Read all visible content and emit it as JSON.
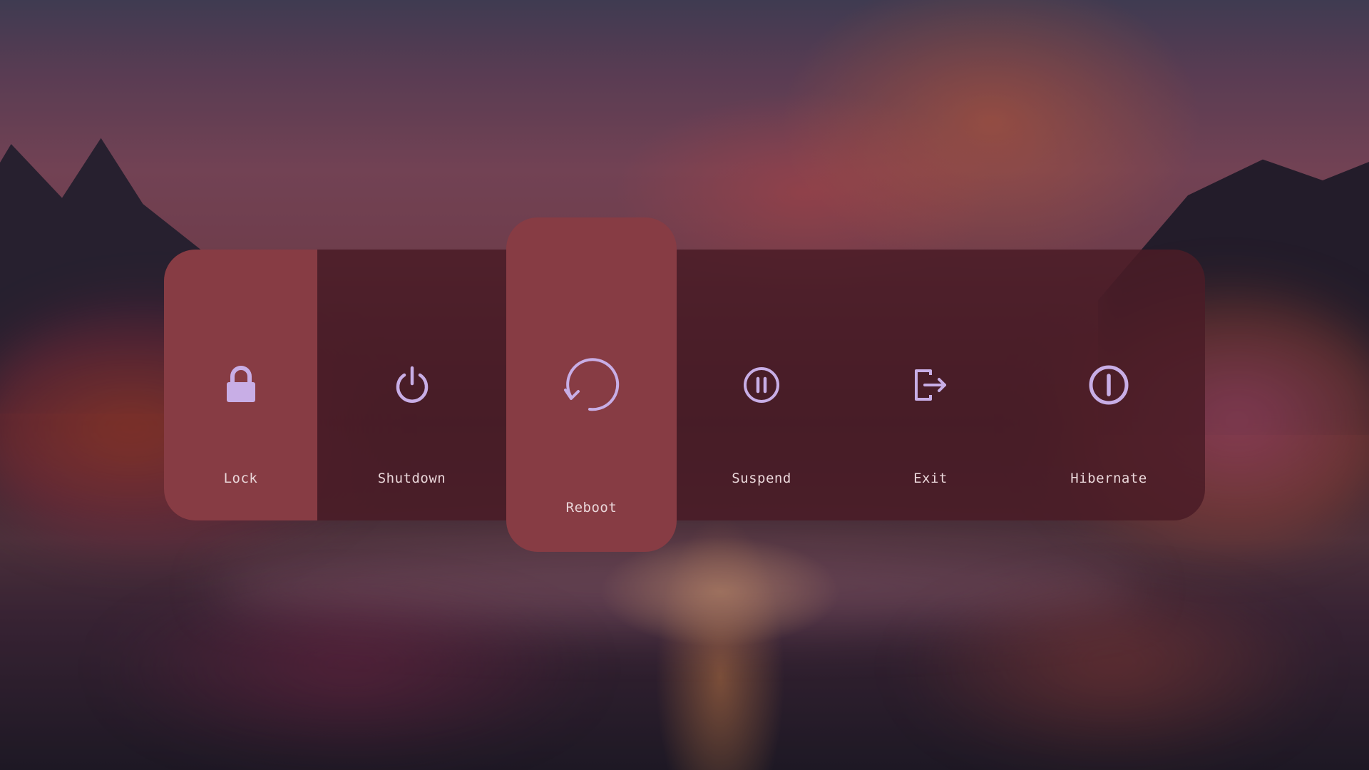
{
  "menu": {
    "items": [
      {
        "id": "lock",
        "label": "Lock",
        "icon": "lock-icon",
        "selected": true
      },
      {
        "id": "shutdown",
        "label": "Shutdown",
        "icon": "power-icon",
        "selected": false
      },
      {
        "id": "reboot",
        "label": "Reboot",
        "icon": "reboot-icon",
        "selected": false,
        "focused": true
      },
      {
        "id": "suspend",
        "label": "Suspend",
        "icon": "pause-circle-icon",
        "selected": false
      },
      {
        "id": "exit",
        "label": "Exit",
        "icon": "exit-icon",
        "selected": false
      },
      {
        "id": "hibernate",
        "label": "Hibernate",
        "icon": "hibernate-icon",
        "selected": false
      }
    ]
  },
  "colors": {
    "panel": "#4a1c26",
    "highlight": "#873c44",
    "icon": "#c8aee6",
    "label": "#ead7da"
  }
}
